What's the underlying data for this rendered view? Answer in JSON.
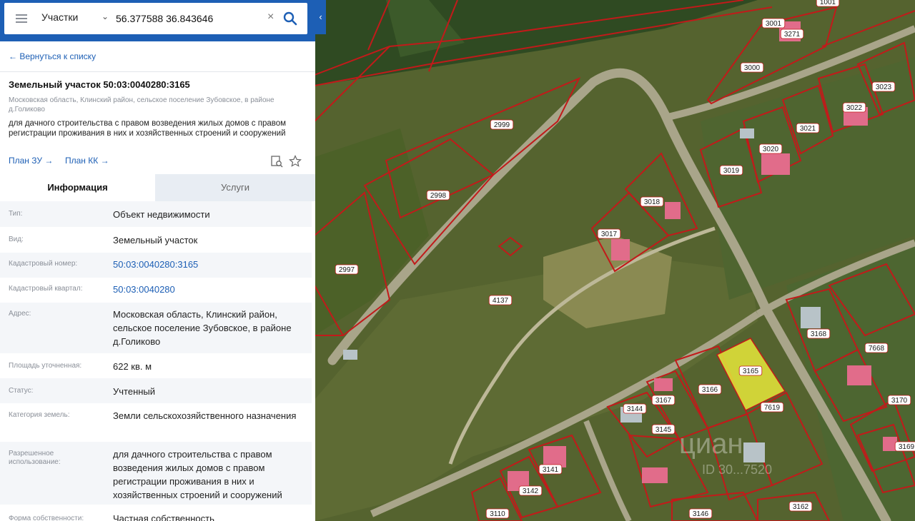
{
  "search": {
    "layer": "Участки",
    "query": "56.377588 36.843646"
  },
  "panel": {
    "back_link": "← Вернуться к списку",
    "title": "Земельный участок 50:03:0040280:3165",
    "location_line": "Московская область, Клинский район, сельское поселение Зубовское, в районе д.Голиково",
    "purpose_line": "для дачного строительства с правом возведения жилых домов с правом регистрации проживания в них и хозяйственных строений и сооружений",
    "plan_zu": "План ЗУ →",
    "plan_kk": "План КК →",
    "tabs": [
      {
        "label": "Информация",
        "active": true
      },
      {
        "label": "Услуги",
        "active": false
      }
    ],
    "rows": [
      {
        "key": "Тип:",
        "value": "Объект недвижимости"
      },
      {
        "key": "Вид:",
        "value": "Земельный участок"
      },
      {
        "key": "Кадастровый номер:",
        "value": "50:03:0040280:3165"
      },
      {
        "key": "Кадастровый квартал:",
        "value": "50:03:0040280"
      },
      {
        "key": "Адрес:",
        "value": "Московская область, Клинский район, сельское поселение Зубовское, в районе д.Голиково"
      },
      {
        "key": "Площадь уточненная:",
        "value": "622 кв. м"
      },
      {
        "key": "Статус:",
        "value": "Учтенный"
      },
      {
        "key": "Категория земель:",
        "value": "Земли сельскохозяйственного назначения"
      },
      {
        "key": "Разрешенное использование:",
        "value": "для дачного строительства с правом возведения жилых домов с правом регистрации проживания в них и хозяйственных строений и сооружений"
      },
      {
        "key": "Форма собственности:",
        "value": "Частная собственность"
      }
    ]
  },
  "map": {
    "parcel_labels": [
      "1001",
      "3001",
      "3271",
      "3000",
      "3023",
      "3022",
      "3021",
      "3020",
      "3019",
      "3018",
      "3017",
      "2999",
      "2998",
      "2997",
      "4137",
      "3168",
      "7668",
      "3170",
      "3165",
      "3166",
      "3167",
      "3144",
      "3145",
      "7619",
      "3141",
      "3142",
      "3110",
      "3146",
      "3162",
      "3169"
    ],
    "highlighted_parcel": "3165",
    "watermark": "циан",
    "watermark_id": "ID 30...7520"
  },
  "colors": {
    "accent": "#1d5fb5",
    "boundary": "#c21a1a",
    "highlight": "#e6e63a"
  }
}
